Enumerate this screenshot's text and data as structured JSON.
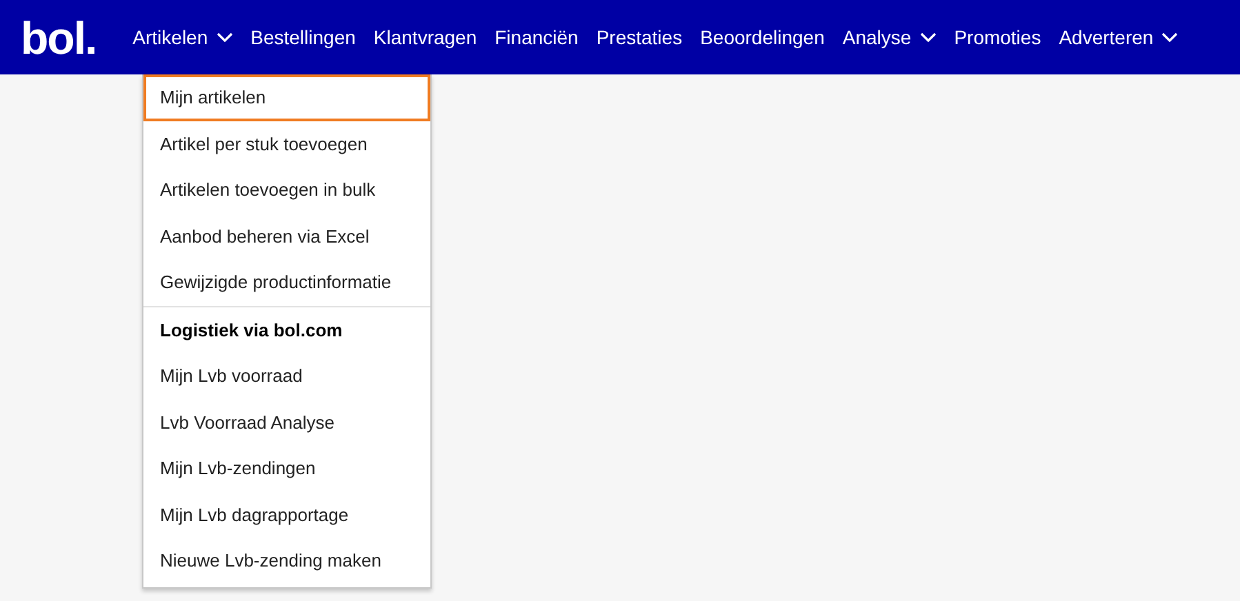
{
  "logo": "bol.",
  "nav": [
    {
      "label": "Artikelen",
      "dropdown": true
    },
    {
      "label": "Bestellingen",
      "dropdown": false
    },
    {
      "label": "Klantvragen",
      "dropdown": false
    },
    {
      "label": "Financiën",
      "dropdown": false
    },
    {
      "label": "Prestaties",
      "dropdown": false
    },
    {
      "label": "Beoordelingen",
      "dropdown": false
    },
    {
      "label": "Analyse",
      "dropdown": true
    },
    {
      "label": "Promoties",
      "dropdown": false
    },
    {
      "label": "Adverteren",
      "dropdown": true
    }
  ],
  "menu": [
    {
      "kind": "link",
      "label": "Mijn artikelen",
      "selected": true
    },
    {
      "kind": "link",
      "label": "Artikel per stuk toevoegen",
      "selected": false
    },
    {
      "kind": "link",
      "label": "Artikelen toevoegen in bulk",
      "selected": false
    },
    {
      "kind": "link",
      "label": "Aanbod beheren via Excel",
      "selected": false
    },
    {
      "kind": "link",
      "label": "Gewijzigde productinformatie",
      "selected": false
    },
    {
      "kind": "heading",
      "label": "Logistiek via bol.com"
    },
    {
      "kind": "link",
      "label": "Mijn Lvb voorraad",
      "selected": false
    },
    {
      "kind": "link",
      "label": "Lvb Voorraad Analyse",
      "selected": false
    },
    {
      "kind": "link",
      "label": "Mijn Lvb-zendingen",
      "selected": false
    },
    {
      "kind": "link",
      "label": "Mijn Lvb dagrapportage",
      "selected": false
    },
    {
      "kind": "link",
      "label": "Nieuwe Lvb-zending maken",
      "selected": false
    }
  ]
}
